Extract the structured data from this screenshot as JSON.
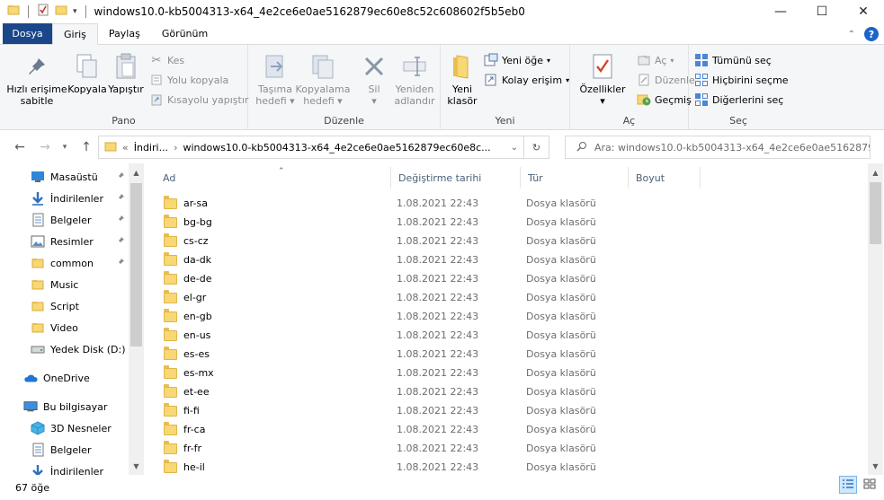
{
  "window": {
    "title": "windows10.0-kb5004313-x64_4e2ce6e0ae5162879ec60e8c52c608602f5b5eb0",
    "min": "—",
    "max": "☐",
    "close": "✕"
  },
  "tabs": {
    "file": "Dosya",
    "home": "Giriş",
    "share": "Paylaş",
    "view": "Görünüm"
  },
  "ribbon": {
    "clipboard": {
      "label": "Pano",
      "pin": [
        "Hızlı erişime",
        "sabitle"
      ],
      "copy": "Kopyala",
      "paste": "Yapıştır",
      "cut": "Kes",
      "copy_path": "Yolu kopyala",
      "paste_shortcut": "Kısayolu yapıştır"
    },
    "organize": {
      "label": "Düzenle",
      "move_to": [
        "Taşıma",
        "hedefi"
      ],
      "copy_to": [
        "Kopyalama",
        "hedefi"
      ],
      "delete": "Sil",
      "rename": [
        "Yeniden",
        "adlandır"
      ]
    },
    "new": {
      "label": "Yeni",
      "new_folder": [
        "Yeni",
        "klasör"
      ],
      "new_item": "Yeni öğe",
      "easy_access": "Kolay erişim"
    },
    "open": {
      "label": "Aç",
      "properties": "Özellikler",
      "open": "Aç",
      "edit": "Düzenle",
      "history": "Geçmiş"
    },
    "select": {
      "label": "Seç",
      "select_all": "Tümünü seç",
      "select_none": "Hiçbirini seçme",
      "invert": "Diğerlerini seç"
    }
  },
  "address": {
    "crumb_prefix": "«",
    "crumb_parent": "İndiri...",
    "crumb_sep": "›",
    "crumb_current": "windows10.0-kb5004313-x64_4e2ce6e0ae5162879ec60e8c...",
    "search_placeholder": "Ara: windows10.0-kb5004313-x64_4e2ce6e0ae5162879e..."
  },
  "nav": {
    "items": [
      {
        "label": "Masaüstü",
        "icon": "desktop-icon",
        "pinned": true
      },
      {
        "label": "İndirilenler",
        "icon": "download-icon",
        "pinned": true
      },
      {
        "label": "Belgeler",
        "icon": "document-icon",
        "pinned": true
      },
      {
        "label": "Resimler",
        "icon": "pictures-icon",
        "pinned": true
      },
      {
        "label": "common",
        "icon": "folder-icon",
        "pinned": true
      },
      {
        "label": "Music",
        "icon": "folder-icon",
        "pinned": false
      },
      {
        "label": "Script",
        "icon": "folder-icon",
        "pinned": false
      },
      {
        "label": "Video",
        "icon": "folder-icon",
        "pinned": false
      },
      {
        "label": "Yedek Disk (D:)",
        "icon": "drive-icon",
        "pinned": false
      },
      {
        "label": "OneDrive",
        "icon": "cloud-icon",
        "pinned": false
      },
      {
        "label": "Bu bilgisayar",
        "icon": "computer-icon",
        "pinned": false
      },
      {
        "label": "3D Nesneler",
        "icon": "cube-icon",
        "pinned": false
      },
      {
        "label": "Belgeler",
        "icon": "document-icon",
        "pinned": false
      },
      {
        "label": "İndirilenler",
        "icon": "download-icon",
        "pinned": false
      }
    ]
  },
  "columns": {
    "name": "Ad",
    "date": "Değiştirme tarihi",
    "type": "Tür",
    "size": "Boyut"
  },
  "files": [
    {
      "name": "ar-sa",
      "date": "1.08.2021 22:43",
      "type": "Dosya klasörü"
    },
    {
      "name": "bg-bg",
      "date": "1.08.2021 22:43",
      "type": "Dosya klasörü"
    },
    {
      "name": "cs-cz",
      "date": "1.08.2021 22:43",
      "type": "Dosya klasörü"
    },
    {
      "name": "da-dk",
      "date": "1.08.2021 22:43",
      "type": "Dosya klasörü"
    },
    {
      "name": "de-de",
      "date": "1.08.2021 22:43",
      "type": "Dosya klasörü"
    },
    {
      "name": "el-gr",
      "date": "1.08.2021 22:43",
      "type": "Dosya klasörü"
    },
    {
      "name": "en-gb",
      "date": "1.08.2021 22:43",
      "type": "Dosya klasörü"
    },
    {
      "name": "en-us",
      "date": "1.08.2021 22:43",
      "type": "Dosya klasörü"
    },
    {
      "name": "es-es",
      "date": "1.08.2021 22:43",
      "type": "Dosya klasörü"
    },
    {
      "name": "es-mx",
      "date": "1.08.2021 22:43",
      "type": "Dosya klasörü"
    },
    {
      "name": "et-ee",
      "date": "1.08.2021 22:43",
      "type": "Dosya klasörü"
    },
    {
      "name": "fi-fi",
      "date": "1.08.2021 22:43",
      "type": "Dosya klasörü"
    },
    {
      "name": "fr-ca",
      "date": "1.08.2021 22:43",
      "type": "Dosya klasörü"
    },
    {
      "name": "fr-fr",
      "date": "1.08.2021 22:43",
      "type": "Dosya klasörü"
    },
    {
      "name": "he-il",
      "date": "1.08.2021 22:43",
      "type": "Dosya klasörü"
    }
  ],
  "status": {
    "count": "67 öğe"
  },
  "colors": {
    "file_tab": "#19478a",
    "accent": "#1b64c8",
    "folder": "#f8d775"
  }
}
